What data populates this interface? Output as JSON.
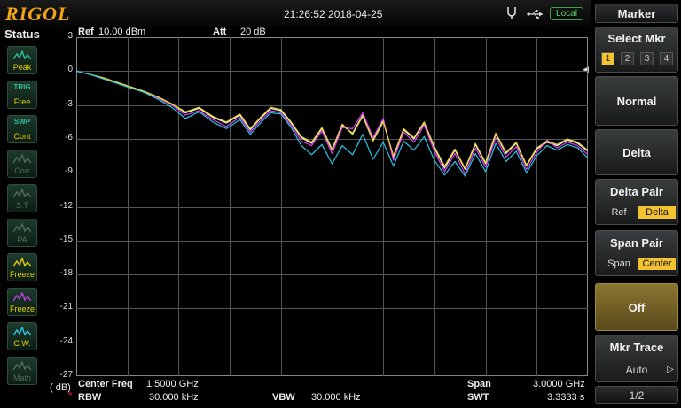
{
  "header": {
    "brand": "RIGOL",
    "datetime": "21:26:52 2018-04-25",
    "local_label": "Local"
  },
  "status": {
    "title": "Status",
    "buttons": [
      {
        "top": "",
        "label": "Peak",
        "state": "active"
      },
      {
        "top": "TRIG",
        "label": "Free",
        "state": "active"
      },
      {
        "top": "SWP",
        "label": "Cont",
        "state": "active"
      },
      {
        "top": "",
        "label": "Corr",
        "state": "dim"
      },
      {
        "top": "",
        "label": "S.T",
        "state": "dim"
      },
      {
        "top": "",
        "label": "PA",
        "state": "dim"
      },
      {
        "top": "",
        "label": "Freeze",
        "state": "active",
        "color": "#e6d000"
      },
      {
        "top": "",
        "label": "Freeze",
        "state": "active",
        "color": "#c040e0"
      },
      {
        "top": "",
        "label": "C.W.",
        "state": "active",
        "color": "#2fc8e8"
      },
      {
        "top": "",
        "label": "Math",
        "state": "dim"
      }
    ]
  },
  "plot": {
    "ref_label": "Ref",
    "ref_value": "10.00 dBm",
    "att_label": "Att",
    "att_value": "20 dB",
    "unit_label": "( dB)",
    "marker_symbol": "◀",
    "y_ticks": [
      "3",
      "0",
      "-3",
      "-6",
      "-9",
      "-12",
      "-15",
      "-18",
      "-21",
      "-24",
      "-27"
    ]
  },
  "chart_data": {
    "type": "line",
    "x_start_ghz": 0,
    "x_stop_ghz": 3,
    "ylim": [
      -27,
      3
    ],
    "ylabel": "( dB)",
    "grid": true,
    "series": [
      {
        "color": "#f2f2f2",
        "x": [
          0,
          0.08,
          0.16,
          0.24,
          0.32,
          0.4,
          0.48,
          0.56,
          0.64,
          0.72,
          0.8,
          0.88,
          0.96,
          1.02,
          1.08,
          1.14,
          1.2,
          1.26,
          1.32,
          1.38,
          1.44,
          1.5,
          1.56,
          1.62,
          1.68,
          1.74,
          1.8,
          1.86,
          1.92,
          1.98,
          2.04,
          2.1,
          2.16,
          2.22,
          2.28,
          2.34,
          2.4,
          2.46,
          2.52,
          2.58,
          2.64,
          2.7,
          2.76,
          2.82,
          2.88,
          2.94,
          3.0
        ],
        "y": [
          0,
          -0.3,
          -0.6,
          -1.0,
          -1.4,
          -1.8,
          -2.3,
          -2.9,
          -3.7,
          -3.3,
          -4.1,
          -4.6,
          -3.9,
          -5.2,
          -4.2,
          -3.3,
          -3.5,
          -4.6,
          -5.9,
          -6.4,
          -5.1,
          -7.0,
          -4.8,
          -5.5,
          -3.9,
          -6.1,
          -4.4,
          -7.6,
          -5.2,
          -6.0,
          -4.6,
          -6.8,
          -8.6,
          -7.0,
          -8.7,
          -6.5,
          -8.2,
          -5.6,
          -7.3,
          -6.4,
          -8.4,
          -6.9,
          -6.3,
          -6.6,
          -6.1,
          -6.4,
          -7.1
        ]
      },
      {
        "color": "#e040f0",
        "x": [
          0,
          0.08,
          0.16,
          0.24,
          0.32,
          0.4,
          0.48,
          0.56,
          0.64,
          0.72,
          0.8,
          0.88,
          0.96,
          1.02,
          1.08,
          1.14,
          1.2,
          1.26,
          1.32,
          1.38,
          1.44,
          1.5,
          1.56,
          1.62,
          1.68,
          1.74,
          1.8,
          1.86,
          1.92,
          1.98,
          2.04,
          2.1,
          2.16,
          2.22,
          2.28,
          2.34,
          2.4,
          2.46,
          2.52,
          2.58,
          2.64,
          2.7,
          2.76,
          2.82,
          2.88,
          2.94,
          3.0
        ],
        "y": [
          0,
          -0.3,
          -0.7,
          -1.1,
          -1.5,
          -1.9,
          -2.4,
          -3.0,
          -3.9,
          -3.5,
          -4.3,
          -4.9,
          -4.1,
          -5.4,
          -4.4,
          -3.5,
          -3.7,
          -4.8,
          -6.2,
          -6.6,
          -5.3,
          -7.3,
          -5.0,
          -5.1,
          -3.7,
          -5.9,
          -4.2,
          -7.9,
          -5.4,
          -6.3,
          -4.8,
          -7.1,
          -8.9,
          -7.3,
          -9.1,
          -6.8,
          -8.5,
          -5.9,
          -7.6,
          -6.7,
          -8.7,
          -7.2,
          -6.1,
          -6.8,
          -6.3,
          -6.6,
          -7.4
        ]
      },
      {
        "color": "#e8d820",
        "x": [
          0,
          0.08,
          0.16,
          0.24,
          0.32,
          0.4,
          0.48,
          0.56,
          0.64,
          0.72,
          0.8,
          0.88,
          0.96,
          1.02,
          1.08,
          1.14,
          1.2,
          1.26,
          1.32,
          1.38,
          1.44,
          1.5,
          1.56,
          1.62,
          1.68,
          1.74,
          1.8,
          1.86,
          1.92,
          1.98,
          2.04,
          2.1,
          2.16,
          2.22,
          2.28,
          2.34,
          2.4,
          2.46,
          2.52,
          2.58,
          2.64,
          2.7,
          2.76,
          2.82,
          2.88,
          2.94,
          3.0
        ],
        "y": [
          0,
          -0.3,
          -0.6,
          -1.0,
          -1.4,
          -1.8,
          -2.3,
          -2.9,
          -3.6,
          -3.2,
          -4.0,
          -4.5,
          -3.8,
          -5.1,
          -4.1,
          -3.2,
          -3.4,
          -4.5,
          -5.8,
          -6.3,
          -5.0,
          -6.9,
          -4.7,
          -5.6,
          -4.0,
          -6.2,
          -4.5,
          -7.5,
          -5.1,
          -5.9,
          -4.5,
          -6.7,
          -8.4,
          -6.9,
          -8.6,
          -6.4,
          -8.1,
          -5.5,
          -7.2,
          -6.3,
          -8.3,
          -6.8,
          -6.2,
          -6.5,
          -6.0,
          -6.3,
          -7.0
        ]
      },
      {
        "color": "#20c8e8",
        "x": [
          0,
          0.08,
          0.16,
          0.24,
          0.32,
          0.4,
          0.48,
          0.56,
          0.64,
          0.72,
          0.8,
          0.88,
          0.96,
          1.02,
          1.08,
          1.14,
          1.2,
          1.26,
          1.32,
          1.38,
          1.44,
          1.5,
          1.56,
          1.62,
          1.68,
          1.74,
          1.8,
          1.86,
          1.92,
          1.98,
          2.04,
          2.1,
          2.16,
          2.22,
          2.28,
          2.34,
          2.4,
          2.46,
          2.52,
          2.58,
          2.64,
          2.7,
          2.76,
          2.82,
          2.88,
          2.94,
          3.0
        ],
        "y": [
          0,
          -0.3,
          -0.7,
          -1.1,
          -1.5,
          -1.9,
          -2.5,
          -3.2,
          -4.2,
          -3.6,
          -4.5,
          -5.1,
          -4.3,
          -5.6,
          -4.6,
          -3.7,
          -3.8,
          -5.0,
          -6.6,
          -7.4,
          -6.5,
          -8.2,
          -6.6,
          -7.4,
          -5.6,
          -7.8,
          -6.3,
          -8.4,
          -6.2,
          -7.0,
          -5.8,
          -7.9,
          -9.2,
          -8.0,
          -9.3,
          -7.3,
          -8.9,
          -6.4,
          -8.0,
          -7.1,
          -9.0,
          -7.5,
          -6.6,
          -7.0,
          -6.5,
          -6.8,
          -7.7
        ]
      }
    ]
  },
  "footer": {
    "center_label": "Center Freq",
    "center_value": "1.5000 GHz",
    "span_label": "Span",
    "span_value": "3.0000 GHz",
    "rbw_label": "RBW",
    "rbw_value": "30.000 kHz",
    "vbw_label": "VBW",
    "vbw_value": "30.000 kHz",
    "swt_label": "SWT",
    "swt_value": "3.3333 s"
  },
  "menu": {
    "title": "Marker",
    "select_mkr": {
      "label": "Select Mkr",
      "options": [
        "1",
        "2",
        "3",
        "4"
      ],
      "selected": 0
    },
    "normal": "Normal",
    "delta": "Delta",
    "delta_pair": {
      "label": "Delta Pair",
      "options": [
        "Ref",
        "Delta"
      ],
      "selected": 1
    },
    "span_pair": {
      "label": "Span Pair",
      "options": [
        "Span",
        "Center"
      ],
      "selected": 1
    },
    "off": "Off",
    "mkr_trace": {
      "label": "Mkr Trace",
      "value": "Auto"
    },
    "page": "1/2"
  }
}
